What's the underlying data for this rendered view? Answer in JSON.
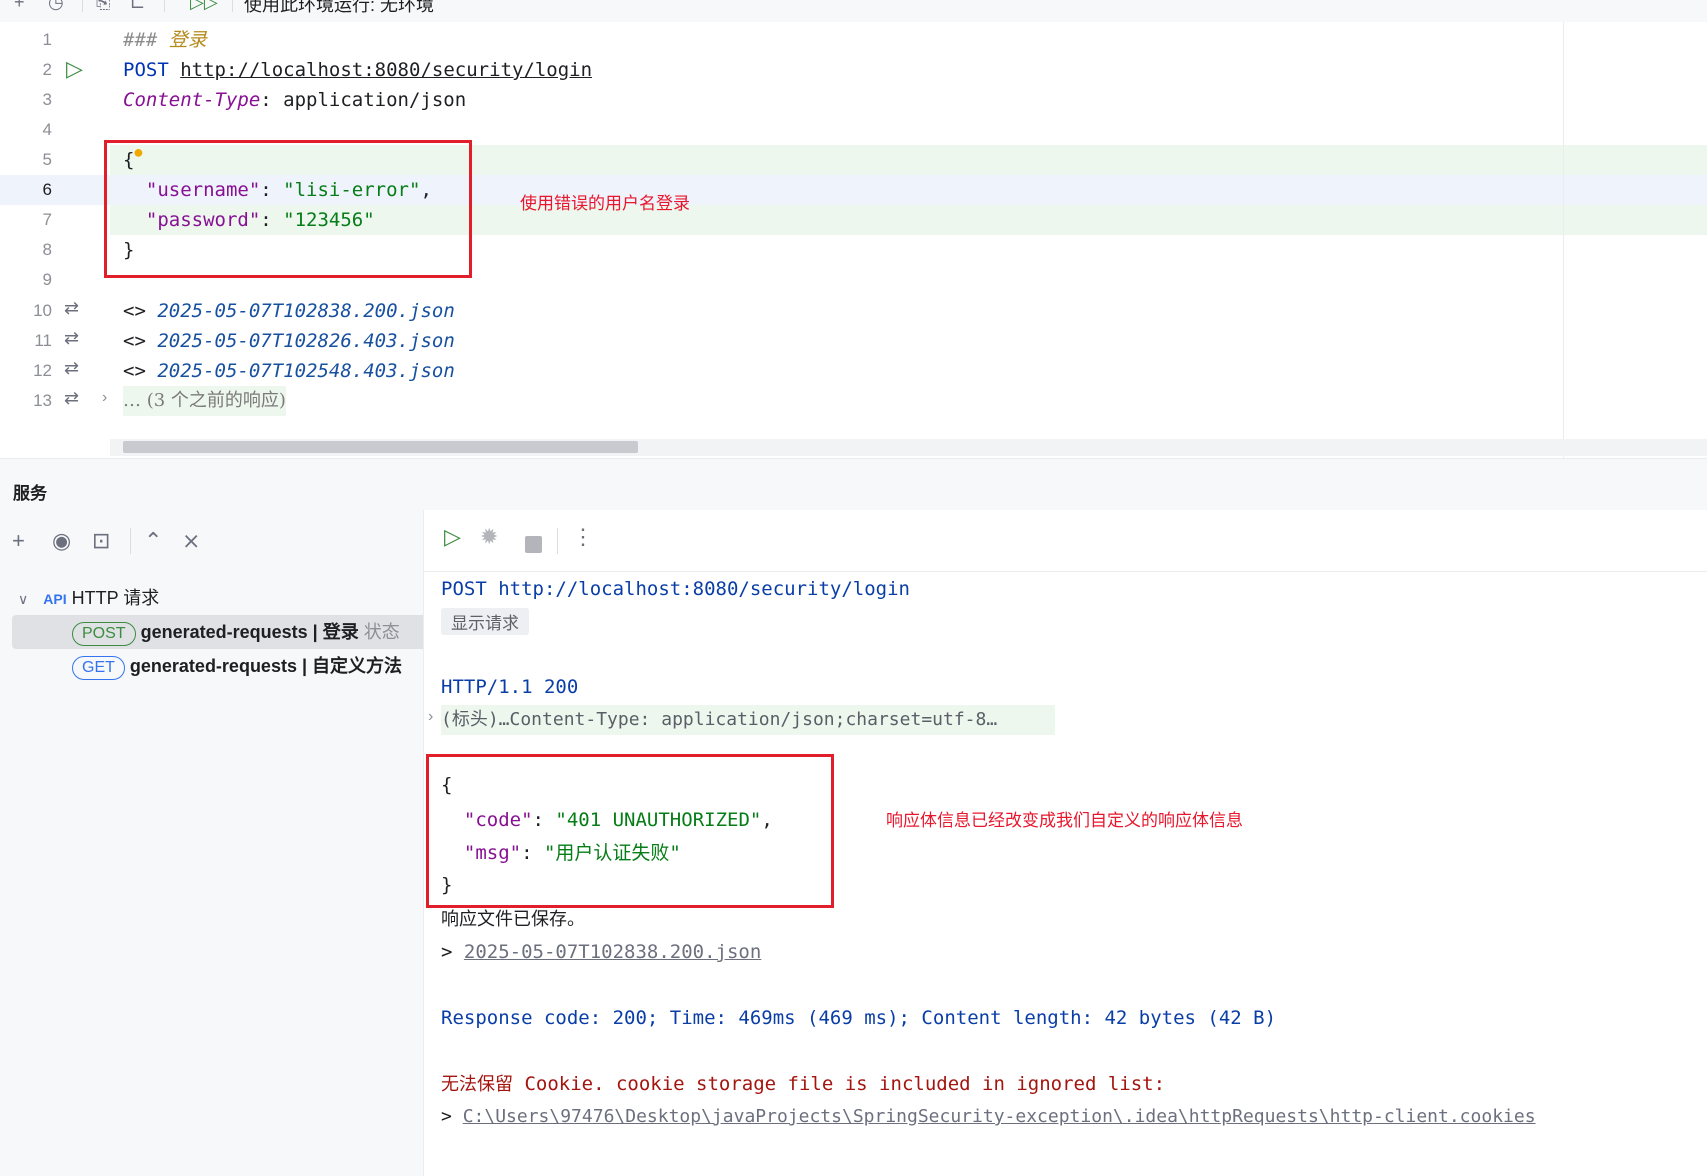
{
  "topbar": {
    "env_label": "使用此环境运行: 无环境"
  },
  "editor": {
    "line_numbers": [
      "1",
      "2",
      "3",
      "4",
      "5",
      "6",
      "7",
      "8",
      "9",
      "10",
      "11",
      "12",
      "13"
    ],
    "comment_hash": "###",
    "comment_text": "登录",
    "method": "POST",
    "url": "http://localhost:8080/security/login",
    "header_name": "Content-Type",
    "header_value": ": application/json",
    "brace_open": "{",
    "username_key": "\"username\"",
    "username_value": "\"lisi-error\"",
    "password_key": "\"password\"",
    "password_value": "\"123456\"",
    "brace_close": "}",
    "history": [
      "2025-05-07T102838.200.json",
      "2025-05-07T102826.403.json",
      "2025-05-07T102548.403.json"
    ],
    "history_prefix": "<>",
    "more_responses": "… (3 个之前的响应)",
    "annotation": "使用错误的用户名登录"
  },
  "services": {
    "title": "服务",
    "tree_root": "HTTP 请求",
    "items": [
      {
        "method": "POST",
        "name": "generated-requests",
        "sep": "|",
        "label": "登录",
        "status": "状态"
      },
      {
        "method": "GET",
        "name": "generated-requests",
        "sep": "|",
        "label": "自定义方法"
      }
    ]
  },
  "output": {
    "request_line": "POST http://localhost:8080/security/login",
    "show_request": "显示请求",
    "status_line": "HTTP/1.1 200",
    "headers_line": "(标头)…Content-Type: application/json;charset=utf-8…",
    "body_open": "{",
    "code_key": "\"code\"",
    "code_value": "\"401 UNAUTHORIZED\"",
    "msg_key": "\"msg\"",
    "msg_value": "\"用户认证失败\"",
    "body_close": "}",
    "saved": "响应文件已保存。",
    "saved_file": "2025-05-07T102838.200.json",
    "summary": "Response code: 200; Time: 469ms (469 ms); Content length: 42 bytes (42 B)",
    "cookie_cn": "无法保留",
    "cookie_msg": "Cookie. cookie storage file is included in ignored list:",
    "cookie_path": "C:\\Users\\97476\\Desktop\\javaProjects\\SpringSecurity-exception\\.idea\\httpRequests\\http-client.cookies",
    "annotation": "响应体信息已经改变成我们自定义的响应体信息"
  },
  "colors": {
    "annotation_red": "#e8162c",
    "box_red": "#e01f2a",
    "string_green": "#067d17",
    "keyword_blue": "#0033b3"
  }
}
